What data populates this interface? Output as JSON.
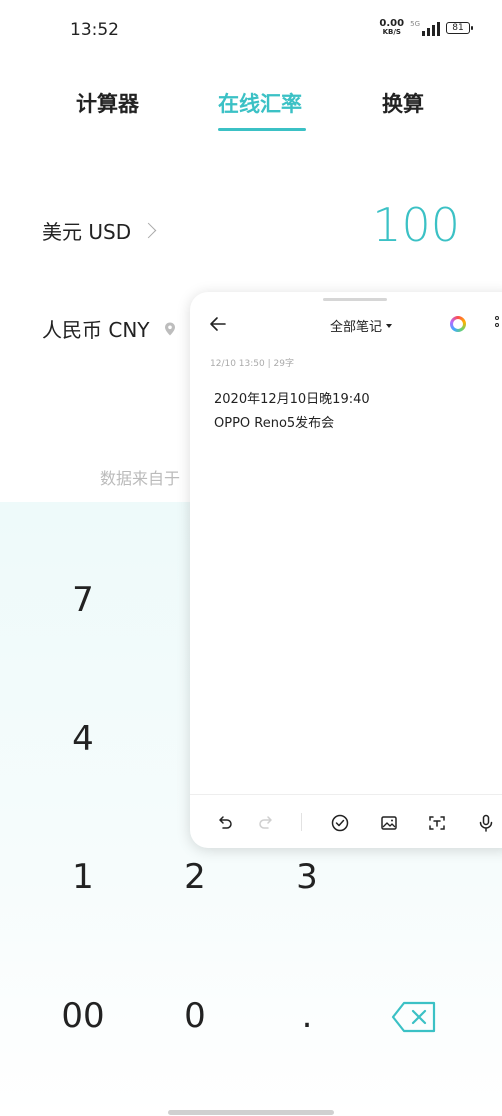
{
  "status": {
    "time": "13:52",
    "net_speed": "0.00",
    "net_unit": "KB/S",
    "signal": "5G",
    "battery": "81"
  },
  "tabs": [
    {
      "label": "计算器"
    },
    {
      "label": "在线汇率"
    },
    {
      "label": "换算"
    }
  ],
  "converter": {
    "from_currency": "美元 USD",
    "from_amount": "100",
    "to_currency": "人民币 CNY",
    "source_text": "数据来自于"
  },
  "keypad": {
    "keys": [
      "7",
      "4",
      "1",
      "2",
      "3",
      "00",
      "0",
      "."
    ],
    "backspace_icon": "backspace-icon"
  },
  "notes": {
    "title": "全部笔记",
    "meta": "12/10 13:50 | 29字",
    "lines": [
      "2020年12月10日晚19:40",
      "OPPO Reno5发布会"
    ],
    "toolbar_icons": [
      "undo-icon",
      "redo-icon",
      "checklist-icon",
      "image-icon",
      "scan-text-icon",
      "microphone-icon"
    ]
  },
  "colors": {
    "accent": "#3bc1c5"
  }
}
